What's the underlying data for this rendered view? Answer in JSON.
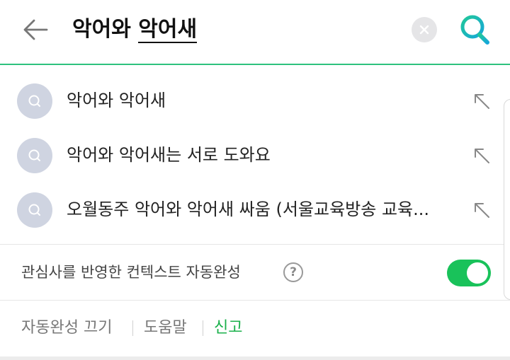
{
  "search": {
    "query_committed": "악어와 ",
    "query_composing": "악어새"
  },
  "suggestions": [
    {
      "text": "악어와 악어새"
    },
    {
      "text": "악어와 악어새는 서로 도와요"
    },
    {
      "text": "오월동주 악어와 악어새 싸움 (서울교육방송 교육..."
    }
  ],
  "context": {
    "label": "관심사를 반영한 컨텍스트 자동완성",
    "help": "?",
    "enabled": true
  },
  "footer": {
    "turn_off": "자동완성 끄기",
    "help": "도움말",
    "report": "신고"
  },
  "colors": {
    "accent_green": "#2ec27e",
    "toggle_green": "#19c25a",
    "report_green": "#19b04a",
    "suggest_circle": "#cfd4e1"
  },
  "icons": {
    "back": "back-arrow-icon",
    "clear": "clear-icon",
    "search": "search-icon",
    "suggest": "search-circle-icon",
    "fill": "fill-query-arrow-icon"
  }
}
